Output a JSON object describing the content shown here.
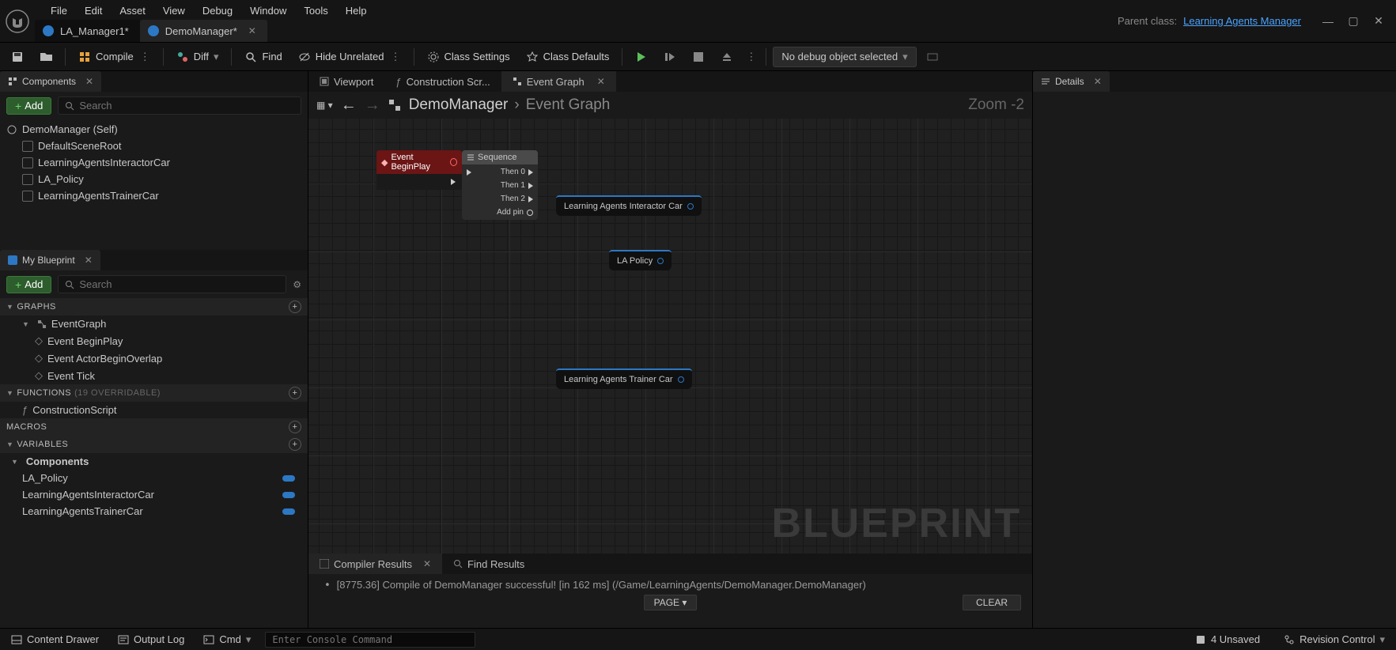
{
  "menu": {
    "file": "File",
    "edit": "Edit",
    "asset": "Asset",
    "view": "View",
    "debug": "Debug",
    "window": "Window",
    "tools": "Tools",
    "help": "Help"
  },
  "docTabs": {
    "tab1": "LA_Manager1*",
    "tab2": "DemoManager*"
  },
  "parentClass": {
    "label": "Parent class:",
    "link": "Learning Agents Manager"
  },
  "toolbar": {
    "compile": "Compile",
    "diff": "Diff",
    "find": "Find",
    "hideUnrelated": "Hide Unrelated",
    "classSettings": "Class Settings",
    "classDefaults": "Class Defaults",
    "debugSelect": "No debug object selected"
  },
  "componentsPanel": {
    "title": "Components",
    "add": "Add",
    "searchPlaceholder": "Search",
    "root": "DemoManager (Self)",
    "items": [
      "DefaultSceneRoot",
      "LearningAgentsInteractorCar",
      "LA_Policy",
      "LearningAgentsTrainerCar"
    ]
  },
  "myBlueprint": {
    "title": "My Blueprint",
    "add": "Add",
    "searchPlaceholder": "Search",
    "graphs": {
      "header": "GRAPHS",
      "root": "EventGraph",
      "events": [
        "Event BeginPlay",
        "Event ActorBeginOverlap",
        "Event Tick"
      ]
    },
    "functions": {
      "header": "FUNCTIONS",
      "override": "(19 OVERRIDABLE)",
      "items": [
        "ConstructionScript"
      ]
    },
    "macros": {
      "header": "MACROS"
    },
    "variables": {
      "header": "VARIABLES",
      "group": "Components",
      "items": [
        "LA_Policy",
        "LearningAgentsInteractorCar",
        "LearningAgentsTrainerCar"
      ]
    }
  },
  "centerTabs": {
    "viewport": "Viewport",
    "construction": "Construction Scr...",
    "eventGraph": "Event Graph"
  },
  "graph": {
    "breadcrumbRoot": "DemoManager",
    "breadcrumbLeaf": "Event Graph",
    "zoom": "Zoom -2",
    "eventNode": "Event BeginPlay",
    "sequenceNode": {
      "title": "Sequence",
      "then0": "Then 0",
      "then1": "Then 1",
      "then2": "Then 2",
      "addPin": "Add pin"
    },
    "refNodes": {
      "interactor": "Learning Agents Interactor Car",
      "policy": "LA Policy",
      "trainer": "Learning Agents Trainer Car"
    },
    "watermark": "BLUEPRINT"
  },
  "compiler": {
    "tab1": "Compiler Results",
    "tab2": "Find Results",
    "message": "[8775.36] Compile of DemoManager successful! [in 162 ms] (/Game/LearningAgents/DemoManager.DemoManager)",
    "page": "PAGE",
    "clear": "CLEAR"
  },
  "detailsPanel": {
    "title": "Details"
  },
  "statusbar": {
    "contentDrawer": "Content Drawer",
    "outputLog": "Output Log",
    "cmd": "Cmd",
    "cmdPlaceholder": "Enter Console Command",
    "unsaved": "4 Unsaved",
    "revision": "Revision Control"
  }
}
